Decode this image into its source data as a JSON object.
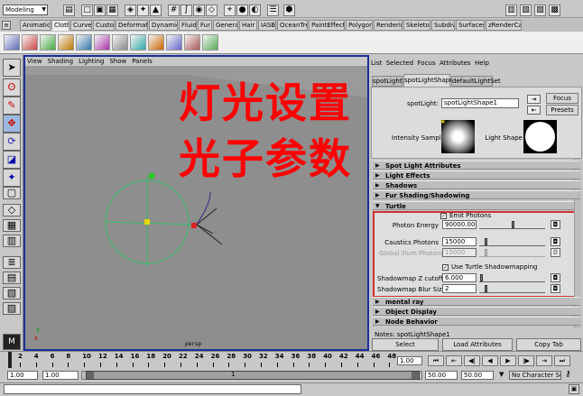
{
  "mode_select": "Modeling",
  "shelf_tabs": [
    "Animation",
    "Cloth",
    "Curves",
    "Custom",
    "Deformation",
    "Dynamics",
    "Fluids",
    "Fur",
    "General",
    "Hair",
    "IASB",
    "OceanTree",
    "PaintEffects",
    "Polygons",
    "Rendering",
    "Skeleton",
    "Subdivs",
    "Surfaces",
    "zRenderCam"
  ],
  "active_shelf": "Cloth",
  "viewport": {
    "menu": [
      "View",
      "Shading",
      "Lighting",
      "Show",
      "Panels"
    ],
    "camera_label": "persp"
  },
  "overlay": {
    "line1": "灯光设置",
    "line2": "光子参数",
    "color": "#ff0000"
  },
  "attr_editor": {
    "menu": [
      "List",
      "Selected",
      "Focus",
      "Attributes",
      "Help"
    ],
    "tabs": [
      "spotLight1",
      "spotLightShape1",
      "defaultLightSet"
    ],
    "active_tab": "spotLightShape1",
    "node_type_label": "spotLight:",
    "node_name": "spotLightShape1",
    "focus_label": "Focus",
    "presets_label": "Presets",
    "intensity_sample_label": "Intensity Sample",
    "light_shape_label": "Light Shape",
    "sections": [
      "Spot Light Attributes",
      "Light Effects",
      "Shadows",
      "Fur Shading/Shadowing"
    ],
    "turtle": {
      "title": "Turtle",
      "emit_photons_label": "Emit Photons",
      "emit_photons": true,
      "photon_energy_label": "Photon Energy",
      "photon_energy": "90000.000",
      "caustics_photons_label": "Caustics Photons",
      "caustics_photons": "15000",
      "gi_photons_label": "Global Illum Photons",
      "gi_photons": "15000",
      "use_shadowmap_label": "Use Turtle Shadowmapping",
      "use_shadowmap": true,
      "shadowmap_z_label": "Shadowmap Z cutoff",
      "shadowmap_z": "6.000",
      "shadowmap_blur_label": "Shadowmap Blur Size",
      "shadowmap_blur": "2"
    },
    "sections_after": [
      "mental ray",
      "Object Display",
      "Node Behavior"
    ],
    "notes_label": "Notes: spotLightShape1",
    "select_label": "Select",
    "load_attrs_label": "Load Attributes",
    "copy_tab_label": "Copy Tab"
  },
  "timeline": {
    "ticks": [
      "2",
      "4",
      "6",
      "8",
      "10",
      "12",
      "14",
      "16",
      "18",
      "20",
      "22",
      "24",
      "26",
      "28",
      "30",
      "32",
      "34",
      "36",
      "38",
      "40",
      "42",
      "44",
      "46",
      "48"
    ],
    "current_frame": "1.00"
  },
  "range": {
    "start": "1.00",
    "start2": "1.00",
    "end": "50.00",
    "end2": "50.00",
    "range_value": "1",
    "char_set": "No Character Set"
  },
  "accent": "#d03030"
}
